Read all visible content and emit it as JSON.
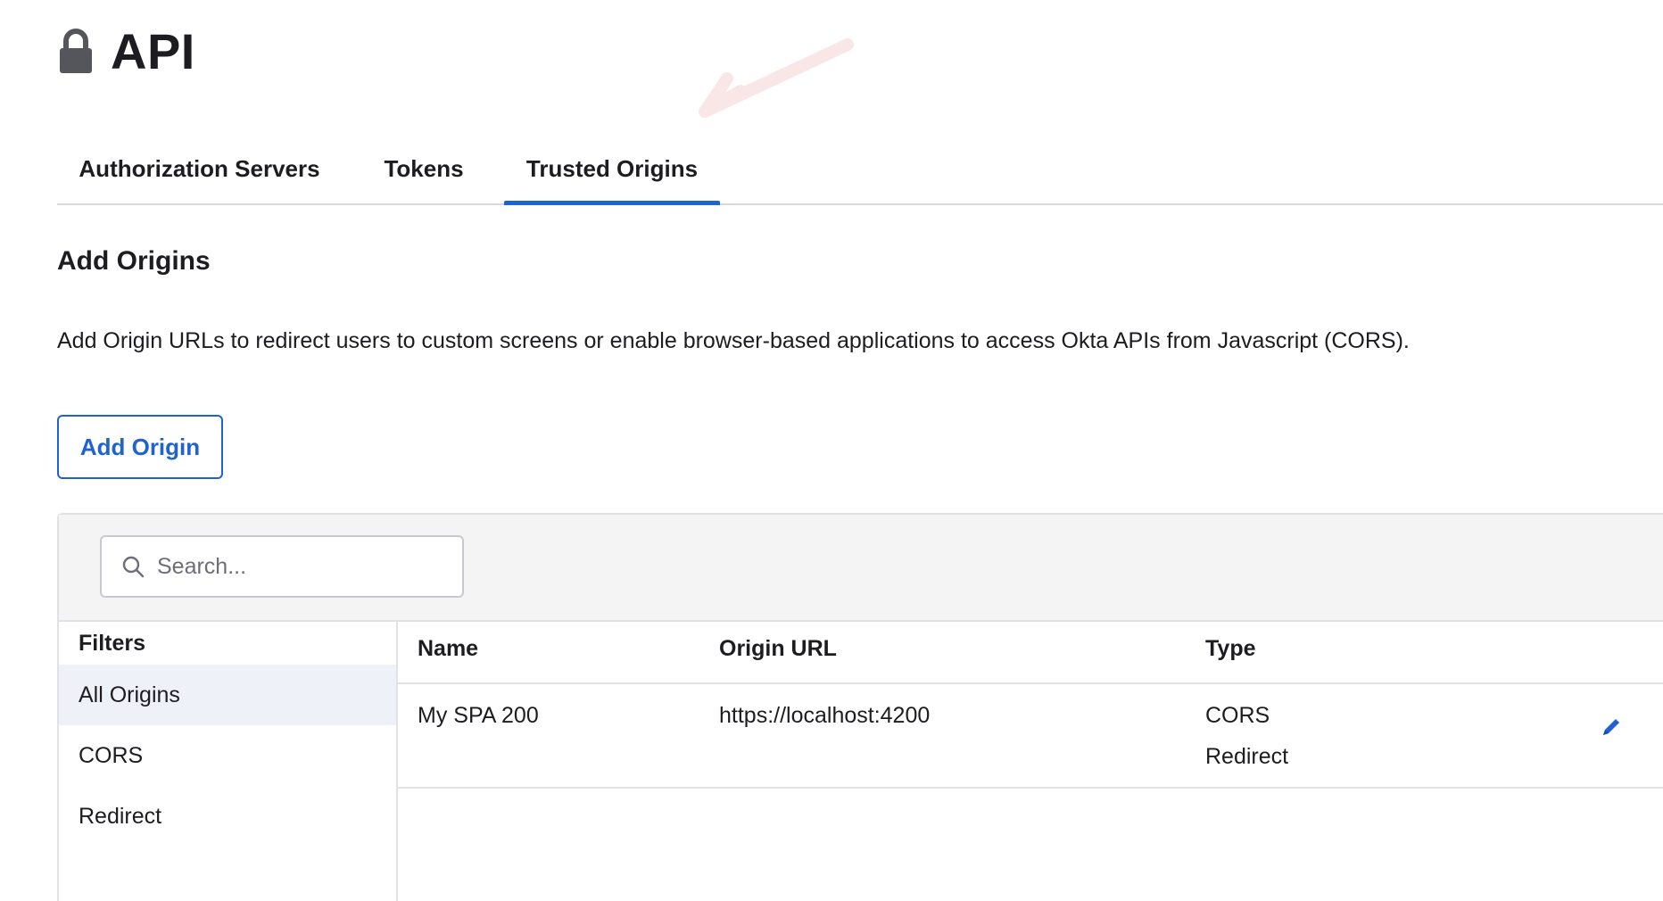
{
  "header": {
    "title": "API",
    "icon": "lock-icon"
  },
  "tabs": [
    {
      "label": "Authorization Servers",
      "active": false
    },
    {
      "label": "Tokens",
      "active": false
    },
    {
      "label": "Trusted Origins",
      "active": true
    }
  ],
  "section": {
    "title": "Add Origins",
    "description": "Add Origin URLs to redirect users to custom screens or enable browser-based applications to access Okta APIs from Javascript (CORS)."
  },
  "add_button": {
    "label": "Add Origin"
  },
  "search": {
    "placeholder": "Search...",
    "value": "",
    "icon": "search-icon"
  },
  "filters": {
    "title": "Filters",
    "items": [
      {
        "label": "All Origins",
        "selected": true
      },
      {
        "label": "CORS",
        "selected": false
      },
      {
        "label": "Redirect",
        "selected": false
      }
    ]
  },
  "table": {
    "columns": [
      "Name",
      "Origin URL",
      "Type"
    ],
    "rows": [
      {
        "name": "My SPA 200",
        "origin_url": "https://localhost:4200",
        "types": [
          "CORS",
          "Redirect"
        ],
        "action_icon": "pencil-edit-icon"
      }
    ]
  },
  "colors": {
    "accent": "#1f62d0",
    "text": "#1d1d21",
    "toolbar_bg": "#f4f4f5",
    "selected_filter_bg": "#eef1f8",
    "border": "#e2e2e6"
  }
}
